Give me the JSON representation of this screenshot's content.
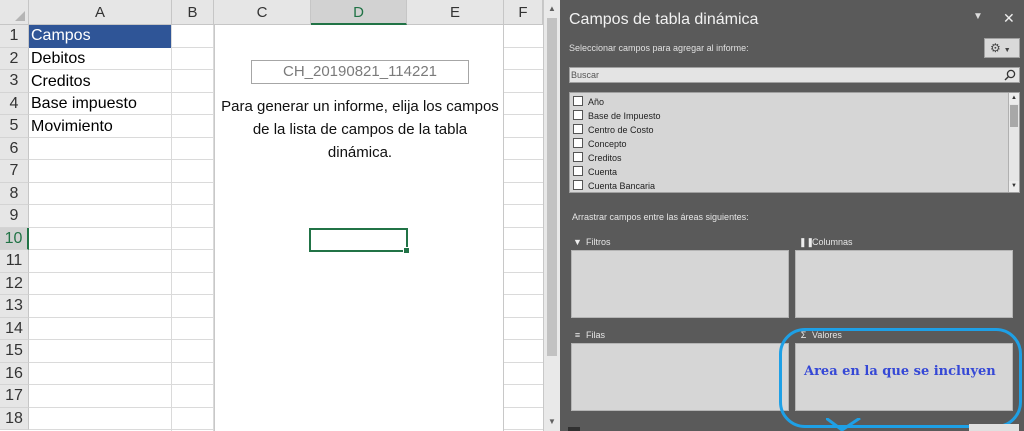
{
  "sheet": {
    "columns": [
      "A",
      "B",
      "C",
      "D",
      "E",
      "F"
    ],
    "selected_column": "D",
    "rows": [
      "1",
      "2",
      "3",
      "4",
      "5",
      "6",
      "7",
      "8",
      "9",
      "10",
      "11",
      "12",
      "13",
      "14",
      "15",
      "16",
      "17",
      "18"
    ],
    "selected_row": "10",
    "cells": [
      "Campos",
      "Debitos",
      "Creditos",
      "Base impuesto",
      "Movimiento"
    ],
    "pivot_name": "CH_20190821_114221",
    "pivot_message": "Para generar un informe, elija los campos de la lista de campos de la tabla dinámica."
  },
  "pane": {
    "title": "Campos de tabla dinámica",
    "instruction": "Seleccionar campos para agregar al informe:",
    "search_placeholder": "Buscar",
    "fields": [
      "Año",
      "Base de Impuesto",
      "Centro de Costo",
      "Concepto",
      "Creditos",
      "Cuenta",
      "Cuenta Bancaria"
    ],
    "drag_instruction": "Arrastrar campos entre las áreas siguientes:",
    "areas": {
      "filters": "Filtros",
      "columns": "Columnas",
      "rows": "Filas",
      "values": "Valores"
    }
  },
  "annotation": {
    "text": "Area en la que se incluyen",
    "color": "#1ea0e6",
    "text_color": "#3548d6"
  },
  "icons": [
    "dropdown-caret-icon",
    "close-icon",
    "gear-icon",
    "search-icon",
    "filter-icon",
    "columns-icon",
    "rows-icon",
    "sigma-icon"
  ]
}
